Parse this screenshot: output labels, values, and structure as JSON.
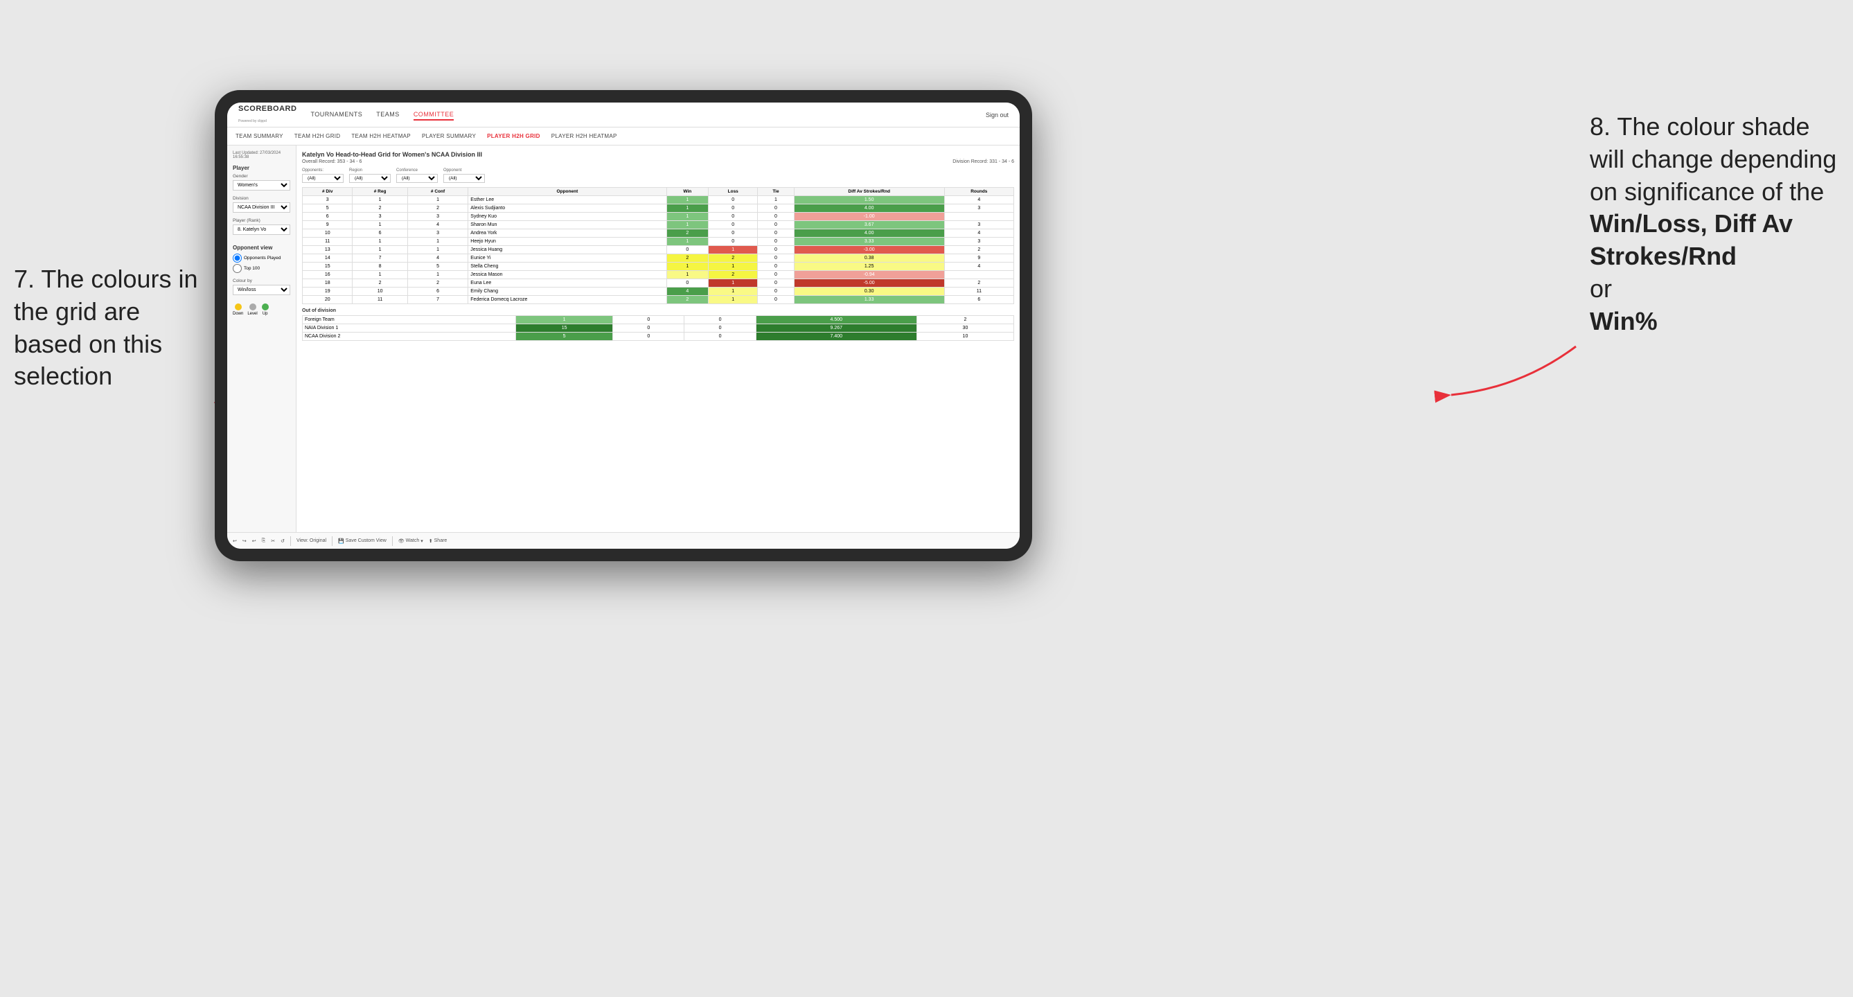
{
  "annotations": {
    "left_number": "7.",
    "left_text": "The colours in the grid are based on this selection",
    "right_number": "8.",
    "right_text": "The colour shade will change depending on significance of the",
    "right_bold1": "Win/Loss,",
    "right_bold2": "Diff Av Strokes/Rnd",
    "right_or": "or",
    "right_bold3": "Win%"
  },
  "nav": {
    "logo": "SCOREBOARD",
    "logo_sub": "Powered by clippd",
    "links": [
      "TOURNAMENTS",
      "TEAMS",
      "COMMITTEE"
    ],
    "active_link": "COMMITTEE",
    "sign_in": "Sign out"
  },
  "sub_nav": {
    "links": [
      "TEAM SUMMARY",
      "TEAM H2H GRID",
      "TEAM H2H HEATMAP",
      "PLAYER SUMMARY",
      "PLAYER H2H GRID",
      "PLAYER H2H HEATMAP"
    ],
    "active_link": "PLAYER H2H GRID"
  },
  "sidebar": {
    "last_updated_label": "Last Updated: 27/03/2024",
    "last_updated_time": "16:55:38",
    "player_section": "Player",
    "gender_label": "Gender",
    "gender_value": "Women's",
    "division_label": "Division",
    "division_value": "NCAA Division III",
    "player_rank_label": "Player (Rank)",
    "player_rank_value": "8. Katelyn Vo",
    "opponent_view_label": "Opponent view",
    "radio1": "Opponents Played",
    "radio2": "Top 100",
    "colour_by_label": "Colour by",
    "colour_by_value": "Win/loss",
    "legend": {
      "down_label": "Down",
      "level_label": "Level",
      "up_label": "Up",
      "down_color": "#f5c518",
      "level_color": "#aaa",
      "up_color": "#4caf50"
    }
  },
  "main": {
    "title": "Katelyn Vo Head-to-Head Grid for Women's NCAA Division III",
    "overall_record_label": "Overall Record:",
    "overall_record": "353 - 34 - 6",
    "division_record_label": "Division Record:",
    "division_record": "331 - 34 - 6",
    "opponents_label": "Opponents:",
    "opponents_value": "(All)",
    "region_label": "Region",
    "region_value": "(All)",
    "conference_label": "Conference",
    "conference_value": "(All)",
    "opponent_label": "Opponent",
    "opponent_value": "(All)",
    "table_headers": [
      "# Div",
      "# Reg",
      "# Conf",
      "Opponent",
      "Win",
      "Loss",
      "Tie",
      "Diff Av Strokes/Rnd",
      "Rounds"
    ],
    "rows": [
      {
        "div": "3",
        "reg": "1",
        "conf": "1",
        "opponent": "Esther Lee",
        "win": "1",
        "loss": "0",
        "tie": "1",
        "diff": "1.50",
        "rounds": "4",
        "win_class": "win-light",
        "loss_class": "",
        "diff_class": "win-light"
      },
      {
        "div": "5",
        "reg": "2",
        "conf": "2",
        "opponent": "Alexis Sudjianto",
        "win": "1",
        "loss": "0",
        "tie": "0",
        "diff": "4.00",
        "rounds": "3",
        "win_class": "win-med",
        "loss_class": "",
        "diff_class": "win-med"
      },
      {
        "div": "6",
        "reg": "3",
        "conf": "3",
        "opponent": "Sydney Kuo",
        "win": "1",
        "loss": "0",
        "tie": "0",
        "diff": "-1.00",
        "rounds": "",
        "win_class": "win-light",
        "loss_class": "",
        "diff_class": "loss-light"
      },
      {
        "div": "9",
        "reg": "1",
        "conf": "4",
        "opponent": "Sharon Mun",
        "win": "1",
        "loss": "0",
        "tie": "0",
        "diff": "3.67",
        "rounds": "3",
        "win_class": "win-light",
        "loss_class": "",
        "diff_class": "win-light"
      },
      {
        "div": "10",
        "reg": "6",
        "conf": "3",
        "opponent": "Andrea York",
        "win": "2",
        "loss": "0",
        "tie": "0",
        "diff": "4.00",
        "rounds": "4",
        "win_class": "win-med",
        "loss_class": "",
        "diff_class": "win-med"
      },
      {
        "div": "11",
        "reg": "1",
        "conf": "1",
        "opponent": "Heejo Hyun",
        "win": "1",
        "loss": "0",
        "tie": "0",
        "diff": "3.33",
        "rounds": "3",
        "win_class": "win-light",
        "loss_class": "",
        "diff_class": "win-light"
      },
      {
        "div": "13",
        "reg": "1",
        "conf": "1",
        "opponent": "Jessica Huang",
        "win": "0",
        "loss": "1",
        "tie": "0",
        "diff": "-3.00",
        "rounds": "2",
        "win_class": "",
        "loss_class": "loss-med",
        "diff_class": "loss-med"
      },
      {
        "div": "14",
        "reg": "7",
        "conf": "4",
        "opponent": "Eunice Yi",
        "win": "2",
        "loss": "2",
        "tie": "0",
        "diff": "0.38",
        "rounds": "9",
        "win_class": "yellow-bg",
        "loss_class": "yellow-bg",
        "diff_class": "yellow-light"
      },
      {
        "div": "15",
        "reg": "8",
        "conf": "5",
        "opponent": "Stella Cheng",
        "win": "1",
        "loss": "1",
        "tie": "0",
        "diff": "1.25",
        "rounds": "4",
        "win_class": "yellow-bg",
        "loss_class": "yellow-bg",
        "diff_class": "yellow-light"
      },
      {
        "div": "16",
        "reg": "1",
        "conf": "1",
        "opponent": "Jessica Mason",
        "win": "1",
        "loss": "2",
        "tie": "0",
        "diff": "-0.94",
        "rounds": "",
        "win_class": "yellow-light",
        "loss_class": "yellow-bg",
        "diff_class": "loss-light"
      },
      {
        "div": "18",
        "reg": "2",
        "conf": "2",
        "opponent": "Euna Lee",
        "win": "0",
        "loss": "1",
        "tie": "0",
        "diff": "-5.00",
        "rounds": "2",
        "win_class": "",
        "loss_class": "loss-dark",
        "diff_class": "loss-dark"
      },
      {
        "div": "19",
        "reg": "10",
        "conf": "6",
        "opponent": "Emily Chang",
        "win": "4",
        "loss": "1",
        "tie": "0",
        "diff": "0.30",
        "rounds": "11",
        "win_class": "win-med",
        "loss_class": "yellow-light",
        "diff_class": "yellow-light"
      },
      {
        "div": "20",
        "reg": "11",
        "conf": "7",
        "opponent": "Federica Domecq Lacroze",
        "win": "2",
        "loss": "1",
        "tie": "0",
        "diff": "1.33",
        "rounds": "6",
        "win_class": "win-light",
        "loss_class": "yellow-light",
        "diff_class": "win-light"
      }
    ],
    "out_of_division_label": "Out of division",
    "out_of_division_rows": [
      {
        "label": "Foreign Team",
        "win": "1",
        "loss": "0",
        "tie": "0",
        "diff": "4.500",
        "rounds": "2",
        "win_class": "win-light",
        "diff_class": "win-med"
      },
      {
        "label": "NAIA Division 1",
        "win": "15",
        "loss": "0",
        "tie": "0",
        "diff": "9.267",
        "rounds": "30",
        "win_class": "win-dark",
        "diff_class": "win-dark"
      },
      {
        "label": "NCAA Division 2",
        "win": "5",
        "loss": "0",
        "tie": "0",
        "diff": "7.400",
        "rounds": "10",
        "win_class": "win-med",
        "diff_class": "win-dark"
      }
    ]
  },
  "toolbar": {
    "view_original": "View: Original",
    "save_custom": "Save Custom View",
    "watch": "Watch",
    "share": "Share"
  }
}
